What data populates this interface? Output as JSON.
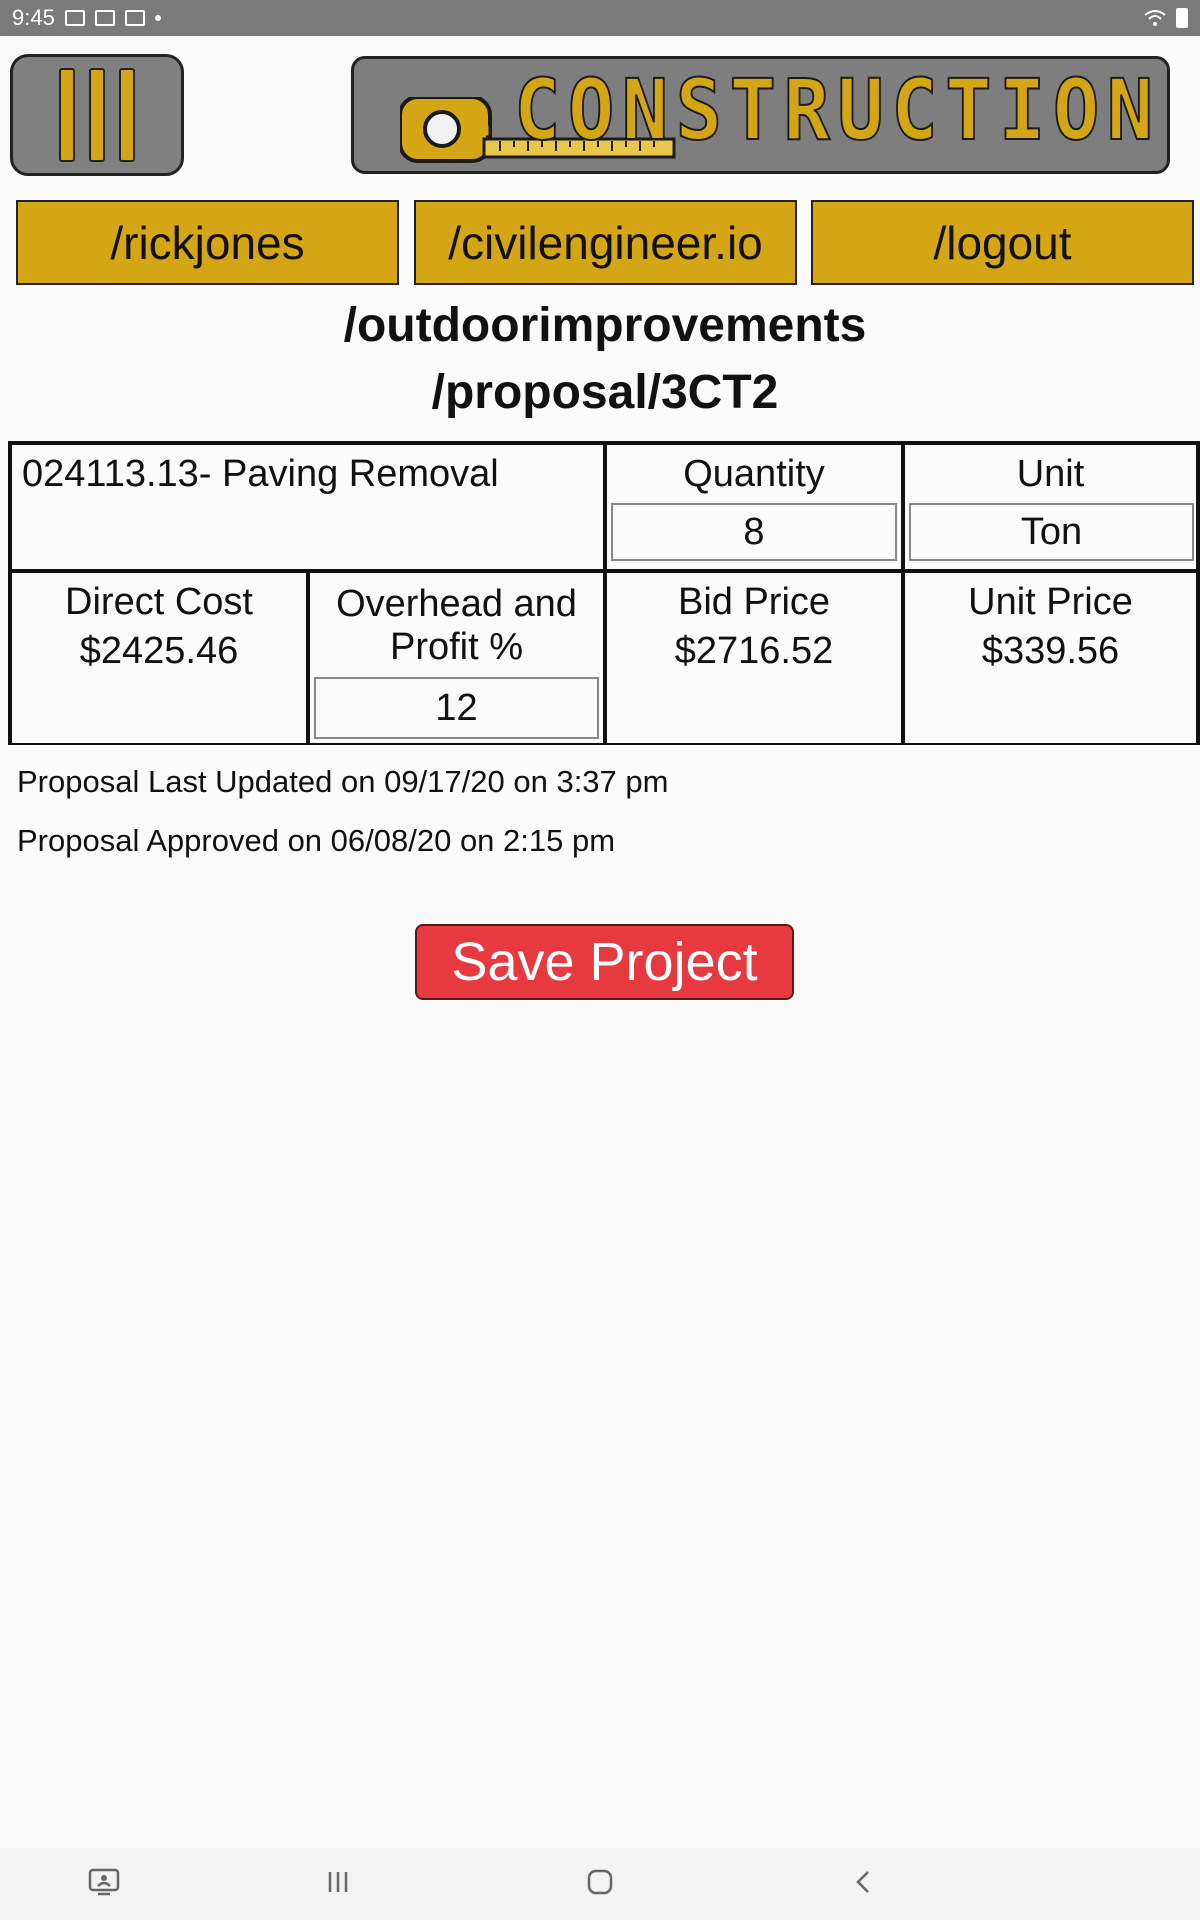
{
  "status_bar": {
    "time": "9:45",
    "icons_left": [
      "image-icon",
      "person-icon",
      "mail-icon",
      "dot-icon"
    ],
    "icons_right": [
      "wifi-icon",
      "battery-icon"
    ]
  },
  "header": {
    "menu_icon": "hamburger-bars-icon",
    "logo_text": "CONSTRUCTION",
    "logo_icon": "tape-measure-icon",
    "brand_color": "#d4a514"
  },
  "nav": {
    "user": "/rickjones",
    "site": "/civilengineer.io",
    "logout": "/logout"
  },
  "page": {
    "title_line1": "/outdoorimprovements",
    "title_line2": "/proposal/3CT2"
  },
  "proposal": {
    "item": "024113.13- Paving Removal",
    "quantity_label": "Quantity",
    "quantity_value": "8",
    "unit_label": "Unit",
    "unit_value": "Ton",
    "direct_cost_label": "Direct Cost",
    "direct_cost_value": "$2425.46",
    "overhead_label_line1": "Overhead and",
    "overhead_label_line2": "Profit %",
    "overhead_value": "12",
    "bid_price_label": "Bid Price",
    "bid_price_value": "$2716.52",
    "unit_price_label": "Unit Price",
    "unit_price_value": "$339.56"
  },
  "notes": {
    "last_updated": "Proposal Last Updated on 09/17/20 on 3:37 pm",
    "approved": "Proposal Approved on 06/08/20 on 2:15 pm"
  },
  "actions": {
    "save_label": "Save Project",
    "save_color": "#e63a40"
  },
  "system_nav": {
    "icons": [
      "screen-mirror-icon",
      "recent-apps-icon",
      "home-icon",
      "back-icon"
    ]
  }
}
